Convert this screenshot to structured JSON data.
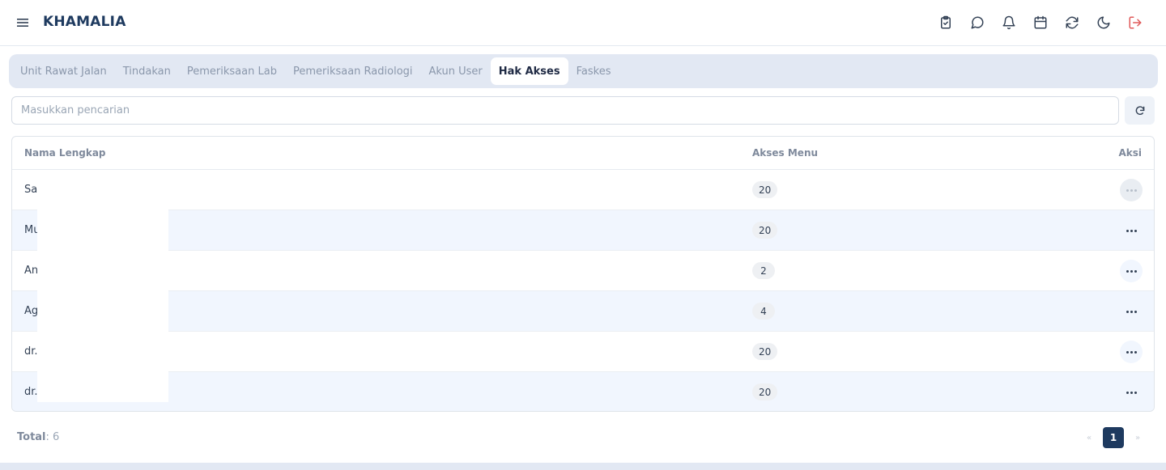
{
  "app": {
    "brand": "KHAMALIA"
  },
  "header": {
    "icons": [
      "clipboard-check-icon",
      "chat-bubble-icon",
      "bell-icon",
      "calendar-icon",
      "sync-icon",
      "moon-icon",
      "logout-icon"
    ],
    "logout_color": "#e05a5a"
  },
  "tabs": [
    {
      "label": "Unit Rawat Jalan",
      "active": false
    },
    {
      "label": "Tindakan",
      "active": false
    },
    {
      "label": "Pemeriksaan Lab",
      "active": false
    },
    {
      "label": "Pemeriksaan Radiologi",
      "active": false
    },
    {
      "label": "Akun User",
      "active": false
    },
    {
      "label": "Hak Akses",
      "active": true
    },
    {
      "label": "Faskes",
      "active": false
    }
  ],
  "search": {
    "placeholder": "Masukkan pencarian",
    "value": ""
  },
  "table": {
    "columns": {
      "name": "Nama Lengkap",
      "menu": "Akses Menu",
      "action": "Aksi"
    },
    "rows": [
      {
        "name": "Sa",
        "menu_count": "20"
      },
      {
        "name": "Mu",
        "menu_count": "20"
      },
      {
        "name": "An",
        "menu_count": "2"
      },
      {
        "name": "Ag",
        "menu_count": "4"
      },
      {
        "name": "dr.",
        "menu_count": "20"
      },
      {
        "name": "dr.",
        "menu_count": "20"
      }
    ]
  },
  "footer": {
    "total_label": "Total",
    "total_value": ": 6"
  },
  "pagination": {
    "prev": "«",
    "current": "1",
    "next": "»"
  },
  "colors": {
    "brand": "#1e3a5f",
    "accent_bg": "#e2e8f3",
    "row_alt": "#f1f6fe"
  }
}
